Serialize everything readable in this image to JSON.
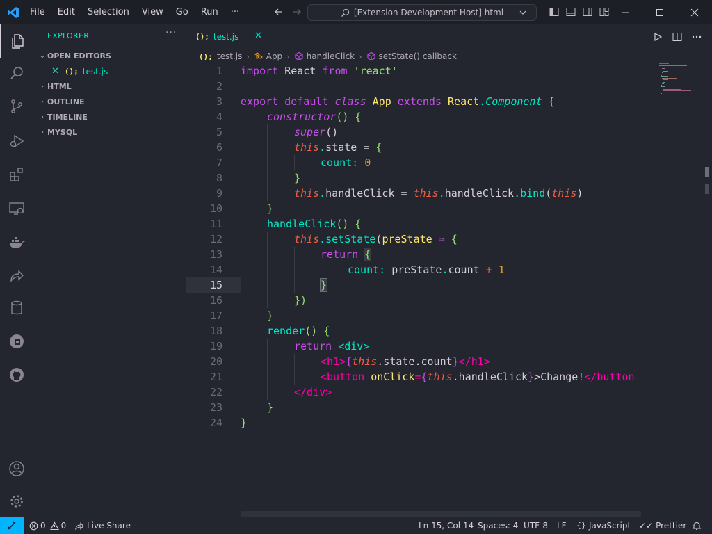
{
  "menu": [
    "File",
    "Edit",
    "Selection",
    "View",
    "Go",
    "Run",
    "···"
  ],
  "command_center": {
    "label": "[Extension Development Host] html"
  },
  "sidebar": {
    "title": "EXPLORER",
    "more": "···",
    "open_editors_label": "OPEN EDITORS",
    "open_editor_file": "test.js",
    "js_badge": "();",
    "sections": [
      "HTML",
      "OUTLINE",
      "TIMELINE",
      "MYSQL"
    ]
  },
  "tab": {
    "badge": "();",
    "label": "test.js"
  },
  "breadcrumb": {
    "file": "test.js",
    "class": "App",
    "method": "handleClick",
    "callback": "setState() callback"
  },
  "editor": {
    "current_line": 15,
    "line_numbers": [
      "1",
      "2",
      "3",
      "4",
      "5",
      "6",
      "7",
      "8",
      "9",
      "10",
      "11",
      "12",
      "13",
      "14",
      "15",
      "16",
      "17",
      "18",
      "19",
      "20",
      "21",
      "22",
      "23",
      "24"
    ]
  },
  "code": {
    "l1": [
      "import",
      " React ",
      "from",
      " 'react'"
    ],
    "l3": [
      "export",
      " default ",
      "class",
      " App ",
      "extends",
      " React",
      ".",
      "Component",
      " {"
    ],
    "l4": [
      "constructor",
      "()",
      " {"
    ],
    "l5": [
      "super",
      "()"
    ],
    "l6": [
      "this",
      ".",
      "state",
      " = ",
      "{"
    ],
    "l7": [
      "count",
      ": ",
      "0"
    ],
    "l8": [
      "}"
    ],
    "l9": [
      "this",
      ".",
      "handleClick",
      " = ",
      "this",
      ".",
      "handleClick",
      ".",
      "bind",
      "(",
      "this",
      ")"
    ],
    "l10": [
      "}"
    ],
    "l11": [
      "handleClick",
      "()",
      " {"
    ],
    "l12": [
      "this",
      ".",
      "setState",
      "(",
      "preState",
      " ⇒ ",
      "{"
    ],
    "l13": [
      "return",
      " ",
      "{"
    ],
    "l14": [
      "count",
      ": ",
      "preState",
      ".",
      "count",
      " + ",
      "1"
    ],
    "l15": [
      "}"
    ],
    "l16": [
      "})"
    ],
    "l17": [
      "}"
    ],
    "l18": [
      "render",
      "()",
      " {"
    ],
    "l19": [
      "return",
      " ",
      "<div>"
    ],
    "l20": [
      "<h1>",
      "{",
      "this",
      ".state.count",
      "}",
      "</h1>"
    ],
    "l21": [
      "<button",
      " onClick",
      "=",
      "{",
      "this",
      ".handleClick",
      "}",
      ">Change!",
      "</button"
    ],
    "l22": [
      "</div>"
    ],
    "l23": [
      "}"
    ],
    "l24": [
      "}"
    ]
  },
  "status": {
    "errors": "0",
    "warnings": "0",
    "live_share": "Live Share",
    "position": "Ln 15, Col 14",
    "spaces": "Spaces: 4",
    "encoding": "UTF-8",
    "eol": "LF",
    "language": "JavaScript",
    "formatter": "Prettier"
  },
  "colors": {
    "accent": "#00e8c6",
    "remote": "#00b4ff",
    "background": "#23262e"
  }
}
